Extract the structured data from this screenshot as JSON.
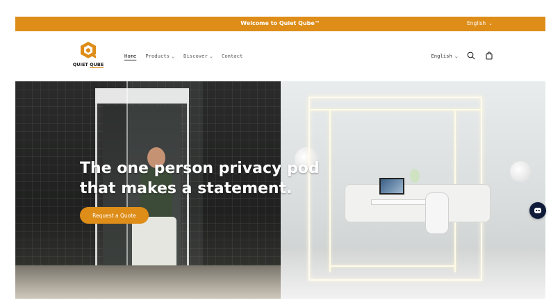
{
  "announcement": {
    "text": "Welcome to Quiet Qube™",
    "language": "English"
  },
  "brand": {
    "name_part1": "QUIET ",
    "name_part2": "QUBE",
    "accent": "#de8d19"
  },
  "nav": {
    "items": [
      {
        "label": "Home",
        "active": true,
        "has_dropdown": false
      },
      {
        "label": "Products",
        "active": false,
        "has_dropdown": true
      },
      {
        "label": "Discover",
        "active": false,
        "has_dropdown": true
      },
      {
        "label": "Contact",
        "active": false,
        "has_dropdown": false
      }
    ],
    "dropdown_glyph": "⌄"
  },
  "header_tools": {
    "language": "English",
    "icons": [
      "search-icon",
      "cart-icon"
    ]
  },
  "hero": {
    "title_line1": "The one person privacy pod",
    "title_line2": "that makes a statement.",
    "cta_label": "Request a Quote"
  },
  "chat": {
    "icon": "chat-bot-icon",
    "color": "#101b3a"
  }
}
